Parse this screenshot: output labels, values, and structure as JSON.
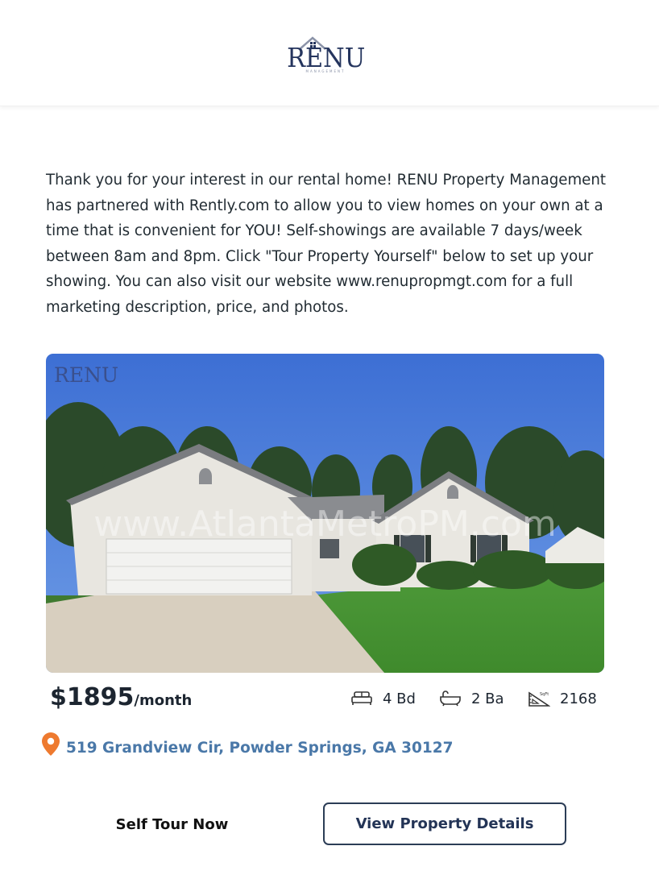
{
  "brand": {
    "logo_text": "RENU",
    "logo_subtext": "MANAGEMENT"
  },
  "intro_text": "Thank you for your interest in our rental home! RENU Property Management has partnered with Rently.com to allow you to view homes on your own at a time that is convenient for YOU! Self-showings are available 7 days/week between 8am and 8pm. Click \"Tour Property Yourself\" below to set up your showing. You can also visit our website www.renupropmgt.com for a full marketing description, price, and photos.",
  "photo": {
    "watermark_logo": "RENU",
    "watermark_url": "www.AtlantaMetroPM.com"
  },
  "listing": {
    "price": "$1895",
    "price_unit": "/month",
    "beds": "4 Bd",
    "baths": "2 Ba",
    "sqft": "2168",
    "sqft_icon_label": "SqFt",
    "address": "519 Grandview Cir, Powder Springs, GA 30127"
  },
  "actions": {
    "self_tour": "Self Tour Now",
    "view_details": "View Property Details"
  },
  "icons": {
    "bed": "bed-icon",
    "bath": "bathtub-icon",
    "sqft": "ruler-icon",
    "pin": "location-pin-icon"
  },
  "colors": {
    "brand_navy": "#25355e",
    "address_link": "#4a78a8",
    "pin_orange": "#ee7a2f",
    "button_border": "#2c3d56"
  }
}
